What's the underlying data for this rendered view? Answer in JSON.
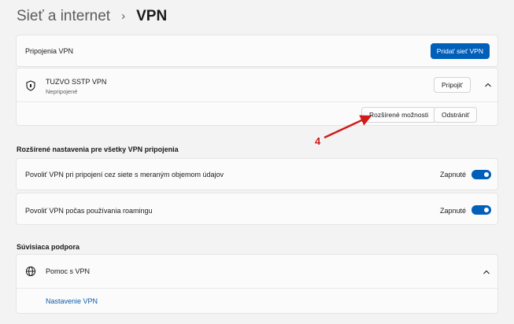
{
  "breadcrumb": {
    "parent": "Sieť a internet",
    "separator": "›",
    "current": "VPN"
  },
  "connections": {
    "label": "Pripojenia VPN",
    "add_button": "Pridať sieť VPN"
  },
  "vpn_item": {
    "name": "TUZVO SSTP VPN",
    "status": "Nepripojené",
    "connect_button": "Pripojiť",
    "advanced_button": "Rozšírené možnosti",
    "remove_button": "Odstrániť"
  },
  "annotation": {
    "number": "4",
    "color": "#d11a1a"
  },
  "advanced_section": {
    "title": "Rozšírené nastavenia pre všetky VPN pripojenia",
    "toggles": [
      {
        "label": "Povoliť VPN pri pripojení cez siete s meraným objemom údajov",
        "state": "Zapnuté"
      },
      {
        "label": "Povoliť VPN počas používania roamingu",
        "state": "Zapnuté"
      }
    ]
  },
  "support_section": {
    "title": "Súvisiaca podpora",
    "help_title": "Pomoc s VPN",
    "link": "Nastavenie VPN"
  },
  "colors": {
    "accent": "#005fb8",
    "link": "#0b5cad"
  }
}
